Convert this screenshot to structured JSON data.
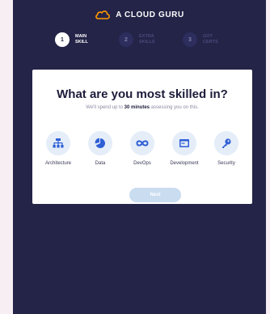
{
  "brand": {
    "name": "A CLOUD GURU",
    "logo_color": "#ff9900"
  },
  "stepper": {
    "steps": [
      {
        "number": "1",
        "label": "MAIN\nSKILL",
        "active": true
      },
      {
        "number": "2",
        "label": "EXTRA\nSKILLS",
        "active": false
      },
      {
        "number": "3",
        "label": "GOT\nCERTS",
        "active": false
      }
    ]
  },
  "card": {
    "title": "What are you most skilled in?",
    "subtitle_before": "We'll spend up to ",
    "subtitle_emphasis": "30 minutes",
    "subtitle_after": " assessing you on this.",
    "options": [
      {
        "label": "Architecture",
        "icon": "architecture-hierarchy-icon"
      },
      {
        "label": "Data",
        "icon": "data-pie-chart-icon"
      },
      {
        "label": "DevOps",
        "icon": "devops-infinity-icon"
      },
      {
        "label": "Development",
        "icon": "development-window-icon"
      },
      {
        "label": "Security",
        "icon": "security-key-icon"
      }
    ],
    "next_label": "Next"
  },
  "colors": {
    "screen_background": "#242448",
    "page_background": "#f6eef2",
    "option_icon": "#2f5fd6",
    "option_circle": "#e4edf8",
    "next_button": "#c9dcf0"
  }
}
